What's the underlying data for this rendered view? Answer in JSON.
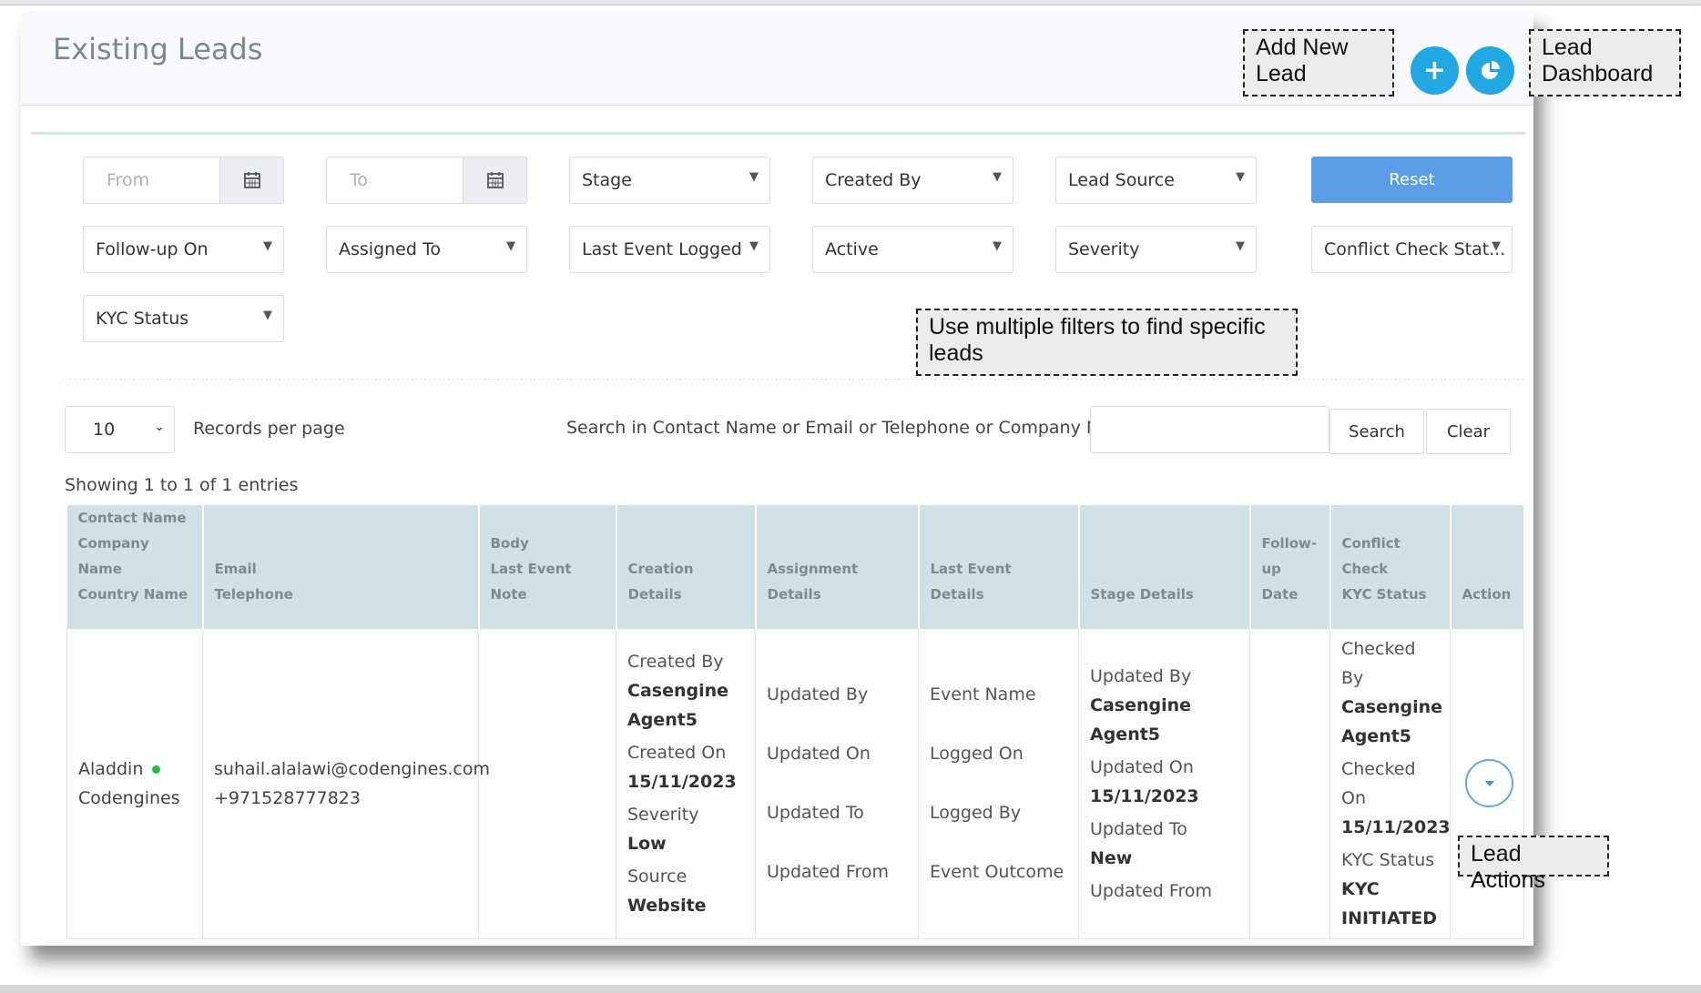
{
  "header": {
    "title": "Existing Leads",
    "add_button_icon": "plus-icon",
    "dashboard_button_icon": "pie-chart-icon"
  },
  "filters": {
    "from_placeholder": "From",
    "to_placeholder": "To",
    "stage": "Stage",
    "created_by": "Created By",
    "lead_source": "Lead Source",
    "reset": "Reset",
    "follow_up_on": "Follow-up On",
    "assigned_to": "Assigned To",
    "last_event_logged": "Last Event Logged",
    "active": "Active",
    "severity": "Severity",
    "conflict_check_status": "Conflict Check Stat...",
    "kyc_status": "KYC Status"
  },
  "listing": {
    "per_page_value": "10",
    "per_page_label": "Records per page",
    "search_label": "Search in Contact Name or Email or Telephone or Company Name",
    "search_value": "",
    "search_button": "Search",
    "clear_button": "Clear",
    "showing": "Showing 1 to 1 of 1 entries"
  },
  "table": {
    "headers": {
      "contact_1": "Contact Name",
      "contact_2": "Company Name",
      "contact_3": "Country Name",
      "email_1": "Email",
      "email_2": "Telephone",
      "body_1": "Body",
      "body_2": "Last Event Note",
      "creation": "Creation Details",
      "assignment": "Assignment Details",
      "last_event": "Last Event Details",
      "stage": "Stage Details",
      "followup_1": "Follow-",
      "followup_2": "up Date",
      "conflict_1": "Conflict",
      "conflict_2": "Check",
      "conflict_3": "KYC Status",
      "action": "Action"
    },
    "row": {
      "contact_name": "Aladdin",
      "company_name": "Codengines",
      "email": "suhail.alalawi@codengines.com",
      "telephone": "+971528777823",
      "creation": {
        "created_by_label": "Created By",
        "created_by_1": "Casengine",
        "created_by_2": "Agent5",
        "created_on_label": "Created On",
        "created_on": "15/11/2023",
        "severity_label": "Severity",
        "severity": "Low",
        "source_label": "Source",
        "source": "Website"
      },
      "assignment": {
        "updated_by_label": "Updated By",
        "updated_on_label": "Updated On",
        "updated_to_label": "Updated To",
        "updated_from_label": "Updated From"
      },
      "last_event": {
        "event_name_label": "Event Name",
        "logged_on_label": "Logged On",
        "logged_by_label": "Logged By",
        "event_outcome_label": "Event Outcome"
      },
      "stage": {
        "updated_by_label": "Updated By",
        "updated_by": "Casengine Agent5",
        "updated_on_label": "Updated On",
        "updated_on": "15/11/2023",
        "updated_to_label": "Updated To",
        "updated_to": "New",
        "updated_from_label": "Updated From"
      },
      "conflict": {
        "checked_by_label": "Checked By",
        "checked_by_1": "Casengine",
        "checked_by_2": "Agent5",
        "checked_on_label": "Checked On",
        "checked_on": "15/11/2023",
        "kyc_label": "KYC Status",
        "kyc_1": "KYC",
        "kyc_2": "INITIATED"
      }
    }
  },
  "callouts": {
    "add_new_lead_1": "Add New",
    "add_new_lead_2": "Lead",
    "lead_dashboard_1": "Lead",
    "lead_dashboard_2": "Dashboard",
    "filters_hint_1": "Use multiple filters to find specific",
    "filters_hint_2": "leads",
    "lead_actions": "Lead Actions"
  },
  "colors": {
    "accent": "#21a7e1",
    "reset_button": "#5b9ee8",
    "table_header": "#d1e2e6",
    "active_dot": "#2db84d"
  }
}
